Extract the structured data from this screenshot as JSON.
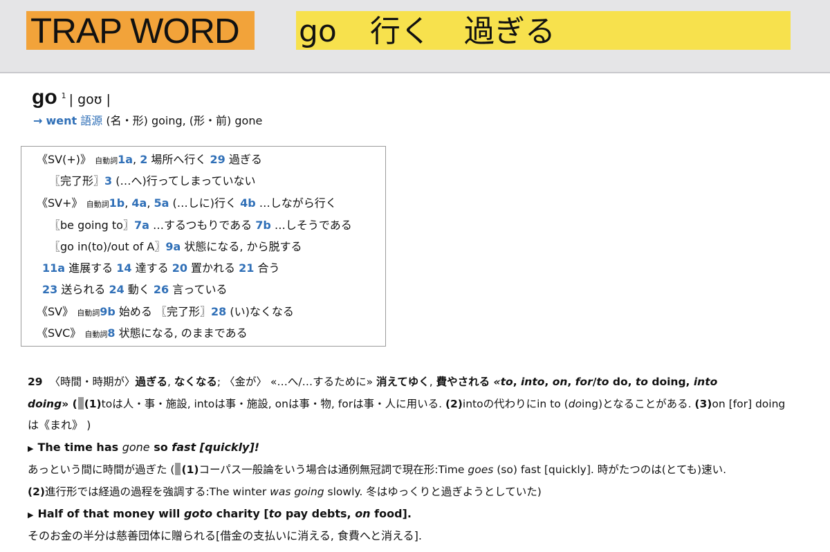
{
  "banner": {
    "trap_label": "TRAP WORD",
    "items": [
      "go",
      "行く",
      "過ぎる"
    ],
    "colors": {
      "trap_bg": "#f2a33a",
      "word_bg": "#f7e14d",
      "bar_bg": "#e5e5e7"
    }
  },
  "entry": {
    "headword": "go",
    "superscript": "1",
    "pronunciation": "| goʊ |",
    "forms": {
      "arrow": "→",
      "past": "went",
      "etymology": "語源",
      "rest": " (名・形) going, (形・前) gone"
    }
  },
  "summary_box": {
    "lines": [
      {
        "a": "《SV(+)》",
        "tag": "自動詞",
        "n1": "1a",
        "t1": ", ",
        "n2": "2",
        "t2": " 場所へ行く ",
        "n3": "29",
        "t3": " 過ぎる"
      },
      {
        "a": "〖完了形〗",
        "n1": "3",
        "t1": " (…へ)行ってしまっていない"
      },
      {
        "a": "《SV+》",
        "tag": "自動詞",
        "n1": "1b",
        "t1": ", ",
        "n2": "4a",
        "t2": ", ",
        "n3": "5a",
        "t3": " (…しに)行く ",
        "n4": "4b",
        "t4": " …しながら行く"
      },
      {
        "a": "〖be going to〗",
        "n1": "7a",
        "t1": " …するつもりである ",
        "n2": "7b",
        "t2": " …しそうである"
      },
      {
        "a": "〖go in(to)/out of A〗",
        "n1": "9a",
        "t1": " 状態になる, から脱する"
      },
      {
        "n1": "11a",
        "t1": " 進展する ",
        "n2": "14",
        "t2": " 達する ",
        "n3": "20",
        "t3": " 置かれる ",
        "n4": "21",
        "t4": " 合う"
      },
      {
        "n1": "23",
        "t1": " 送られる ",
        "n2": "24",
        "t2": " 動く ",
        "n3": "26",
        "t3": " 言っている"
      },
      {
        "a": "《SV》",
        "tag": "自動詞",
        "n1": "9b",
        "t1": " 始める 〖完了形〗",
        "n2": "28",
        "t2": " (い)なくなる"
      },
      {
        "a": "《SVC》",
        "tag": "自動詞",
        "n1": "8",
        "t1": " 状態になる, のままである"
      }
    ]
  },
  "sense29": {
    "number": "29",
    "line1": {
      "ctx1": "〈時間・時期が〉",
      "def1": "過ぎる",
      "sep1": ", ",
      "def2": "なくなる",
      "sep2": "; 〈金が〉 «…へ/…するために» ",
      "def3": "消えてゆく",
      "sep3": ", ",
      "def4": "費やされる",
      "pat1": " «to",
      "c1": ", ",
      "pat2": "into",
      "c2": ", ",
      "pat3": "on",
      "c3": ", ",
      "pat4": "for",
      "c4": "/",
      "pat5": "to",
      "c5": " do, ",
      "pat6": "to",
      "c6": " doing",
      "c7": ", ",
      "pat7": "into"
    },
    "line2": {
      "pat": "doing",
      "close": "» (",
      "n1": "(1)",
      "t1": "toは人・事・施設, intoは事・施設, onは事・物, forは事・人に用いる. ",
      "n2": "(2)",
      "t2": "intoの代わりにin to (",
      "t2i": "do",
      "t2b": "ing)となることがある. ",
      "n3": "(3)",
      "t3": "on [for] doing"
    },
    "line3": "は《まれ》 )",
    "ex1": {
      "tri": "▶",
      "a": "The time has ",
      "b": "gone",
      "c": " so ",
      "d": "fast [quickly]!"
    },
    "ex1_trans": {
      "a": "あっという間に時間が過ぎた (",
      "n1": "(1)",
      "b": "コーパス一般論をいう場合は通例無冠詞で現在形:Time ",
      "c": "goes",
      "d": " (so) fast [quickly]. 時がたつのは(とても)速い."
    },
    "ex1_note": {
      "n2": "(2)",
      "a": "進行形では経過の過程を強調する:The winter ",
      "b": "was going",
      "c": " slowly. 冬はゆっくりと過ぎようとしていた)"
    },
    "ex2": {
      "tri": "▶",
      "a": "Half of that money will ",
      "b": "goto",
      "c": " charity [",
      "d": "to",
      "e": " pay debts, ",
      "f": "on",
      "g": " food]."
    },
    "ex2_trans": "そのお金の半分は慈善団体に贈られる[借金の支払いに消える, 食費へと消える]."
  }
}
